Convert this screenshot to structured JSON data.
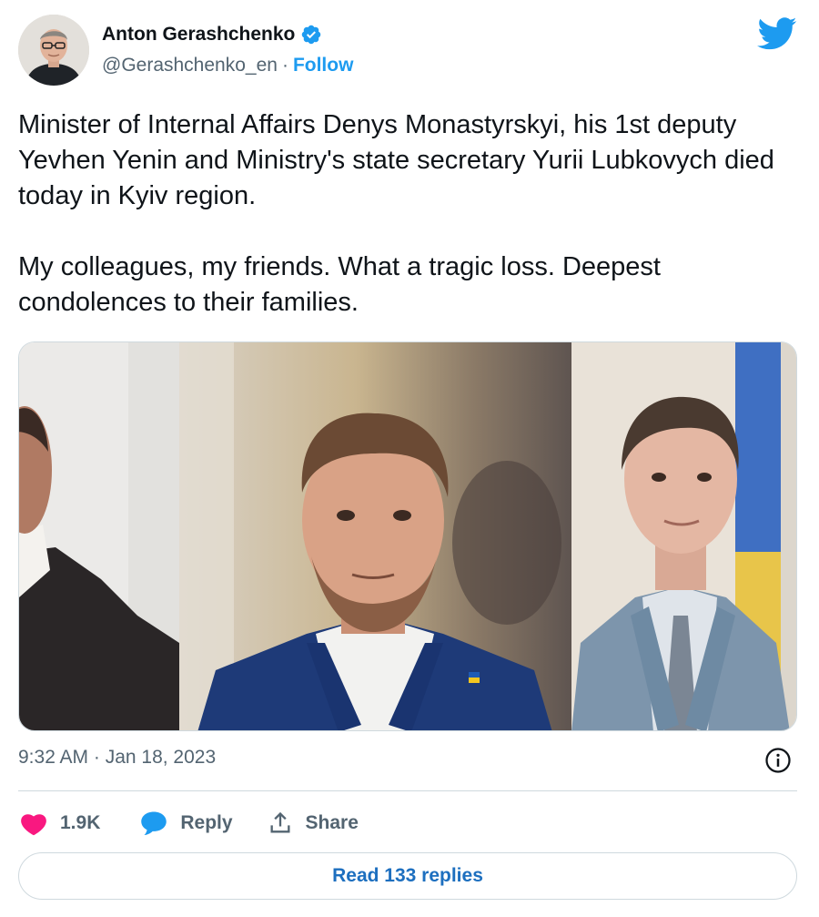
{
  "author": {
    "name": "Anton Gerashchenko",
    "handle": "@Gerashchenko_en",
    "separator": "·",
    "follow_label": "Follow",
    "verified": true
  },
  "tweet": {
    "paragraphs": [
      "Minister of Internal Affairs Denys Monastyrskyi, his 1st deputy Yevhen Yenin and Ministry's state secretary Yurii Lubkovych died today in Kyiv region.",
      "My colleagues, my friends. What a tragic loss. Deepest condolences to their families."
    ],
    "timestamp": "9:32 AM · Jan 18, 2023"
  },
  "actions": {
    "like_count": "1.9K",
    "reply_label": "Reply",
    "share_label": "Share"
  },
  "read_replies_label": "Read 133 replies",
  "icons": {
    "brand": "twitter-bird-icon",
    "verified": "verified-badge-icon",
    "info": "info-icon",
    "like": "heart-icon",
    "reply": "speech-bubble-icon",
    "share": "share-icon"
  },
  "colors": {
    "accent": "#1d9bf0",
    "like": "#f91880",
    "text": "#0f1419",
    "muted": "#536471",
    "border": "#cfd9de"
  }
}
